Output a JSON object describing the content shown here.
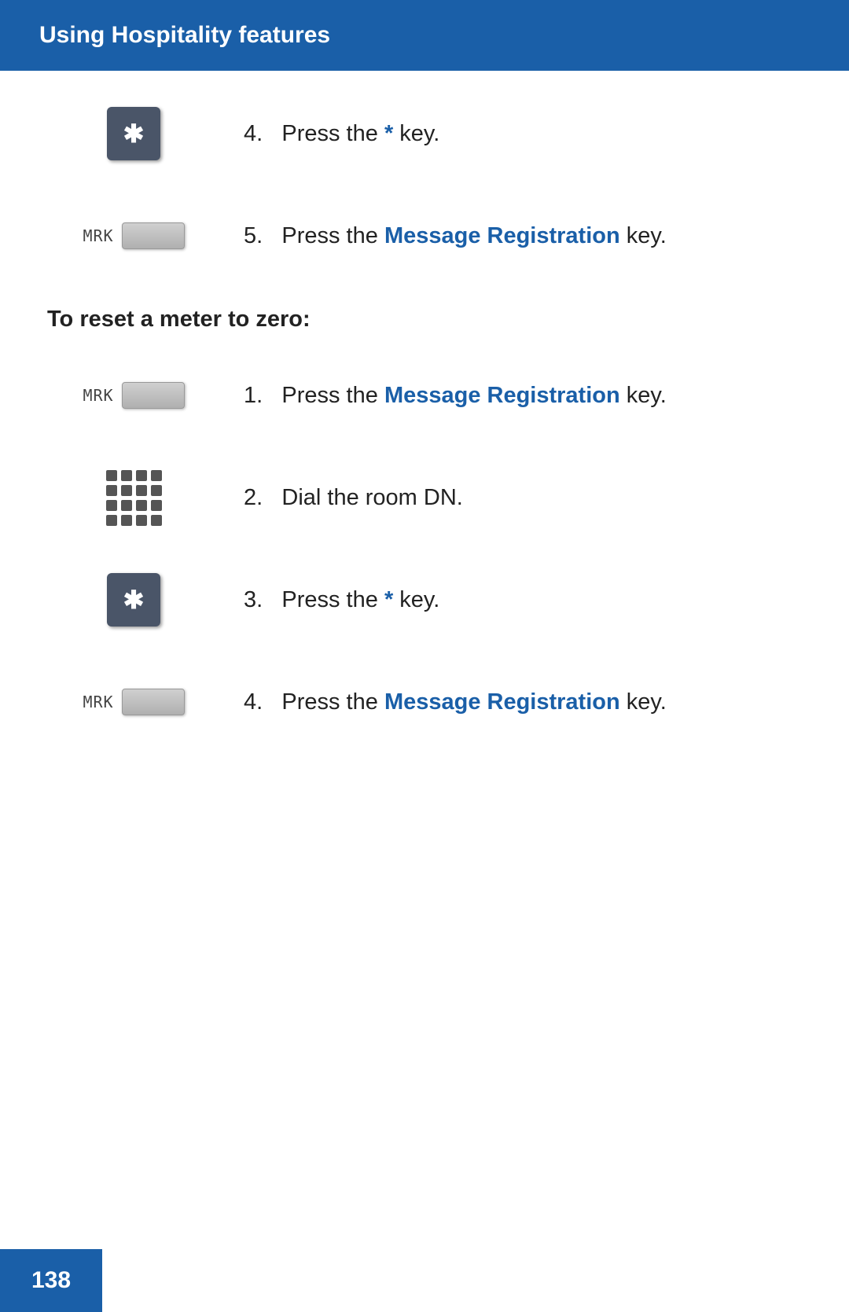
{
  "header": {
    "title": "Using Hospitality features"
  },
  "step4_group": {
    "step_number": "4.",
    "text_before": "Press the ",
    "highlight": "*",
    "text_after": " key."
  },
  "step5_group": {
    "step_number": "5.",
    "text_before": "Press the ",
    "highlight": "Message Registration",
    "text_after": " key."
  },
  "section_heading": "To reset a meter to zero:",
  "reset_steps": [
    {
      "number": "1.",
      "text_before": "Press the ",
      "highlight": "Message Registration",
      "text_after": " key.",
      "icon_type": "mrk"
    },
    {
      "number": "2.",
      "text_before": "Dial the room DN.",
      "highlight": "",
      "text_after": "",
      "icon_type": "keypad"
    },
    {
      "number": "3.",
      "text_before": "Press the ",
      "highlight": "*",
      "text_after": " key.",
      "icon_type": "star"
    },
    {
      "number": "4.",
      "text_before": "Press the ",
      "highlight": "Message Registration",
      "text_after": " key.",
      "icon_type": "mrk"
    }
  ],
  "footer": {
    "page_number": "138"
  },
  "colors": {
    "header_bg": "#1a5fa8",
    "link_color": "#1a5fa8",
    "star_key_bg": "#4a5568",
    "footer_bg": "#1a5fa8"
  }
}
